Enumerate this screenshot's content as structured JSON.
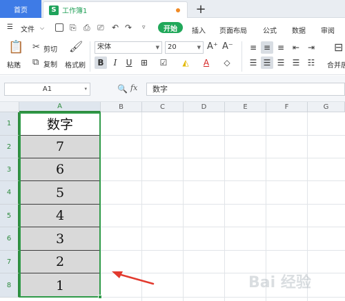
{
  "tabs": {
    "home": "首页",
    "doc_icon": "S",
    "doc_title": "工作簿1",
    "add": "+"
  },
  "menu": {
    "file": "文件",
    "start": "开始",
    "items": [
      "插入",
      "页面布局",
      "公式",
      "数据",
      "审阅"
    ]
  },
  "ribbon": {
    "paste": "粘贴",
    "cut": "剪切",
    "copy": "复制",
    "format_painter": "格式刷",
    "font_name": "宋体",
    "font_size": "20",
    "merge": "合并居"
  },
  "formula_bar": {
    "cell_ref": "A1",
    "fx": "fx",
    "content": "数字"
  },
  "grid": {
    "columns": [
      "A",
      "B",
      "C",
      "D",
      "E",
      "F",
      "G"
    ],
    "rows": [
      "1",
      "2",
      "3",
      "4",
      "5",
      "6",
      "7",
      "8"
    ],
    "col_a": [
      "数字",
      "7",
      "6",
      "5",
      "4",
      "3",
      "2",
      "1"
    ]
  },
  "watermark": "Bai 经验",
  "colors": {
    "accent_green": "#21a85a",
    "home_tab": "#3e7be6",
    "selection": "#2e9a48",
    "arrow": "#e23a2e",
    "cell_fill": "#d9d9d9"
  },
  "icons": [
    "document-s-icon",
    "unsaved-dot-icon",
    "menu-icon",
    "save-icon",
    "undo-icon",
    "redo-icon",
    "print-icon",
    "cut-icon",
    "copy-icon",
    "paste-icon",
    "format-painter-icon",
    "bold-icon",
    "italic-icon",
    "underline-icon",
    "border-icon",
    "fill-color-icon",
    "font-color-icon",
    "clear-icon",
    "align-icons",
    "zoom-icon",
    "fx-icon",
    "red-arrow-icon"
  ]
}
